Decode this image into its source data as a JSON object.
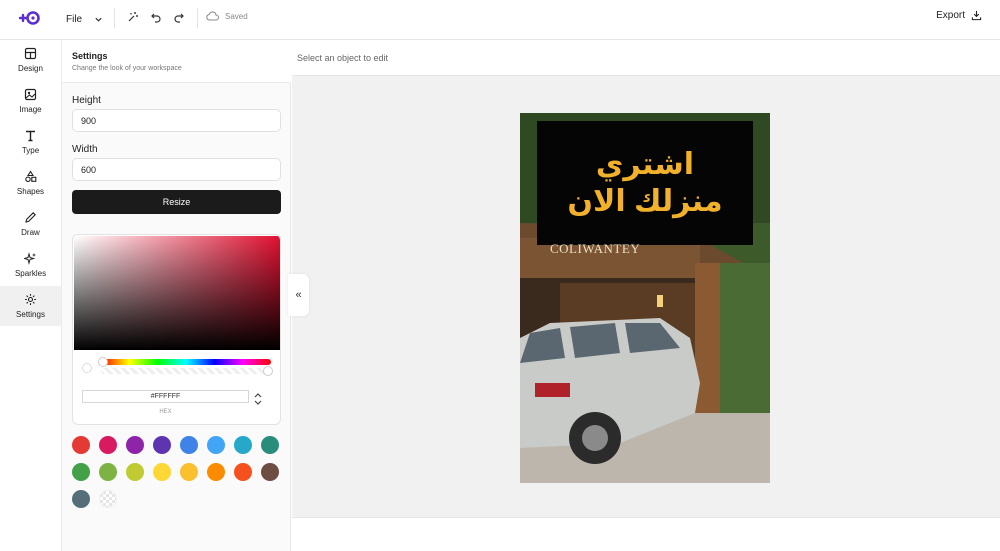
{
  "header": {
    "file_label": "File",
    "saved_label": "Saved",
    "export_label": "Export"
  },
  "rail": {
    "items": [
      {
        "label": "Design",
        "icon": "layout-icon"
      },
      {
        "label": "Image",
        "icon": "image-icon"
      },
      {
        "label": "Type",
        "icon": "type-icon"
      },
      {
        "label": "Shapes",
        "icon": "shapes-icon"
      },
      {
        "label": "Draw",
        "icon": "pencil-icon"
      },
      {
        "label": "Sparkles",
        "icon": "sparkles-icon"
      },
      {
        "label": "Settings",
        "icon": "gear-icon"
      }
    ],
    "active": "Settings"
  },
  "panel": {
    "title": "Settings",
    "subtitle": "Change the look of your workspace",
    "height_label": "Height",
    "height_value": "900",
    "width_label": "Width",
    "width_value": "600",
    "resize_label": "Resize",
    "hex_value": "#FFFFFF",
    "hex_label": "HEX",
    "swatches": [
      "#e53935",
      "#d81b60",
      "#8e24aa",
      "#5e35b1",
      "#3f83e8",
      "#42a5f5",
      "#26a9c9",
      "#2a8c7a",
      "#43a047",
      "#7cb342",
      "#c0ca33",
      "#fdd835",
      "#fbc02d",
      "#fb8c00",
      "#f4511e",
      "#6d4c41",
      "#546e7a",
      "transparent"
    ]
  },
  "canvas": {
    "hint": "Select an object to edit",
    "collapse_glyph": "«",
    "poster": {
      "line1": "اشتري",
      "line2": "منزلك الان",
      "sign_text": "COLIWANTEY",
      "text_color": "#f2b12a",
      "banner_color": "#050505"
    }
  }
}
